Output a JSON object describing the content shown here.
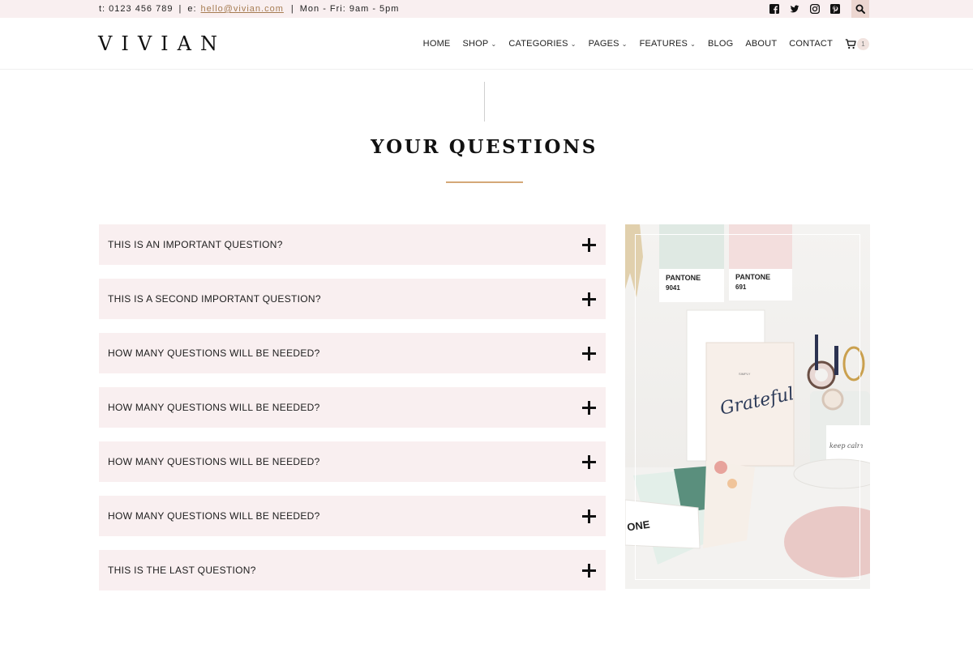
{
  "topbar": {
    "phone": "t: 0123 456 789",
    "separator": "|",
    "email_prefix": "e:",
    "email": "hello@vivian.com",
    "hours": "Mon - Fri: 9am - 5pm",
    "social_icons": [
      "facebook-icon",
      "twitter-icon",
      "instagram-icon",
      "pinterest-icon"
    ],
    "search_icon": "search-icon",
    "background_color": "#f9eff0"
  },
  "header": {
    "logo": "VIVIAN",
    "nav": [
      {
        "label": "HOME",
        "dropdown": false
      },
      {
        "label": "SHOP",
        "dropdown": true
      },
      {
        "label": "CATEGORIES",
        "dropdown": true
      },
      {
        "label": "PAGES",
        "dropdown": true
      },
      {
        "label": "FEATURES",
        "dropdown": true
      },
      {
        "label": "BLOG",
        "dropdown": false
      },
      {
        "label": "ABOUT",
        "dropdown": false
      },
      {
        "label": "CONTACT",
        "dropdown": false
      }
    ],
    "chevron": "⌄",
    "cart_count": "1"
  },
  "section": {
    "title": "YOUR QUESTIONS",
    "accent_color": "#d4a877"
  },
  "faq": {
    "toggle_icon": "plus-icon",
    "items": [
      {
        "question": "THIS IS AN IMPORTANT QUESTION?"
      },
      {
        "question": "THIS IS A SECOND IMPORTANT QUESTION?"
      },
      {
        "question": "HOW MANY QUESTIONS WILL BE NEEDED?"
      },
      {
        "question": "HOW MANY QUESTIONS WILL BE NEEDED?"
      },
      {
        "question": "HOW MANY QUESTIONS WILL BE NEEDED?"
      },
      {
        "question": "HOW MANY QUESTIONS WILL BE NEEDED?"
      },
      {
        "question": "THIS IS THE LAST QUESTION?"
      }
    ],
    "item_background": "#f9eff0"
  },
  "photo": {
    "swatch_1_brand": "PANTONE",
    "swatch_1_code": "9041",
    "swatch_2_brand": "PANTONE",
    "swatch_2_code": "691",
    "notebook_small": "SIMPLY",
    "notebook_script": "Grateful",
    "jar_label": "keep calm",
    "card_text": "ONE"
  }
}
